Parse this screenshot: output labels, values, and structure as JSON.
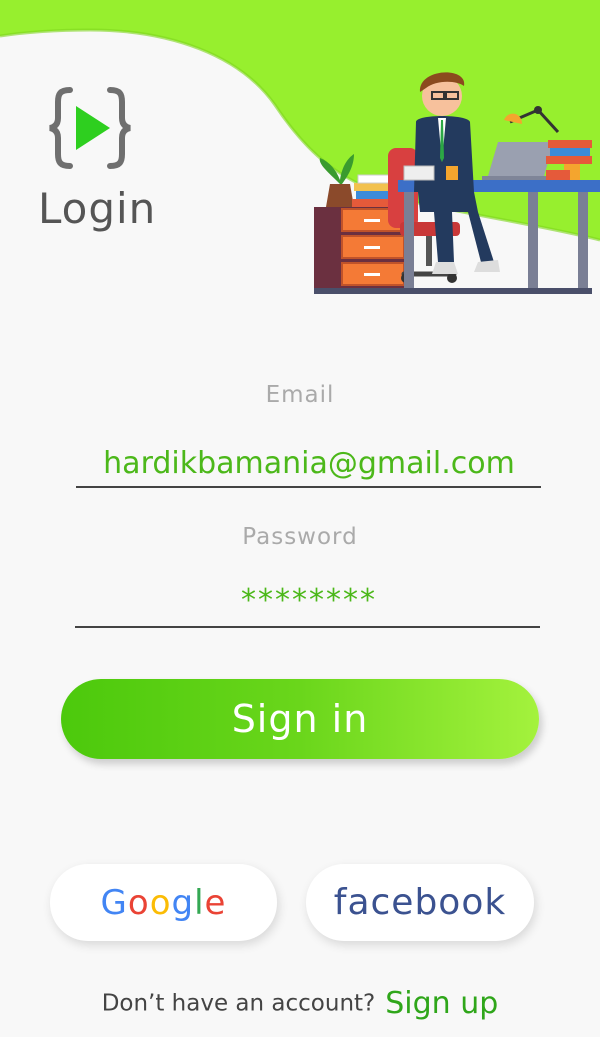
{
  "header": {
    "title": "Login"
  },
  "logo": {
    "icon": "code-play-icon",
    "brace_color": "#6f6f6f",
    "play_color": "#2ecf1f"
  },
  "illustration": {
    "icon": "office-worker-illustration"
  },
  "form": {
    "email_label": "Email",
    "email_value": "hardikbamania@gmail.com",
    "password_label": "Password",
    "password_value": "********"
  },
  "signin": {
    "label": "Sign in"
  },
  "social": {
    "google_letters": [
      "G",
      "o",
      "o",
      "g",
      "l",
      "e"
    ],
    "google_colors": [
      "#4285f4",
      "#ea4335",
      "#fbbc05",
      "#4285f4",
      "#34a853",
      "#ea4335"
    ],
    "facebook_label": "facebook"
  },
  "footer": {
    "prompt": "Don’t have an account?",
    "signup_label": "Sign up"
  },
  "colors": {
    "accent": "#4cc90c",
    "accent_light": "#a4f23d",
    "facebook": "#3b5290",
    "field_text": "#4cb81a"
  }
}
